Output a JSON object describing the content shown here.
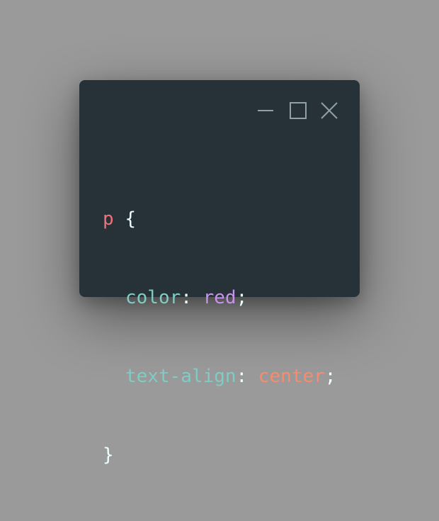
{
  "colors": {
    "background": "#9a9a9a",
    "window_bg": "#263238",
    "control_stroke": "#8fa0a6",
    "selector": "#f07178",
    "brace": "#eeffff",
    "property": "#80cbc4",
    "punctuation": "#eeffff",
    "value_red": "#c792ea",
    "value_center": "#f78c6c"
  },
  "window_controls": {
    "minimize_icon": "minimize-icon",
    "maximize_icon": "maximize-icon",
    "close_icon": "close-icon"
  },
  "code": {
    "line1": {
      "selector": "p",
      "space": " ",
      "open_brace": "{"
    },
    "line2": {
      "property": "color",
      "colon": ": ",
      "value": "red",
      "semicolon": ";"
    },
    "line3": {
      "property": "text-align",
      "colon": ": ",
      "value": "center",
      "semicolon": ";"
    },
    "line4": {
      "close_brace": "}"
    }
  }
}
